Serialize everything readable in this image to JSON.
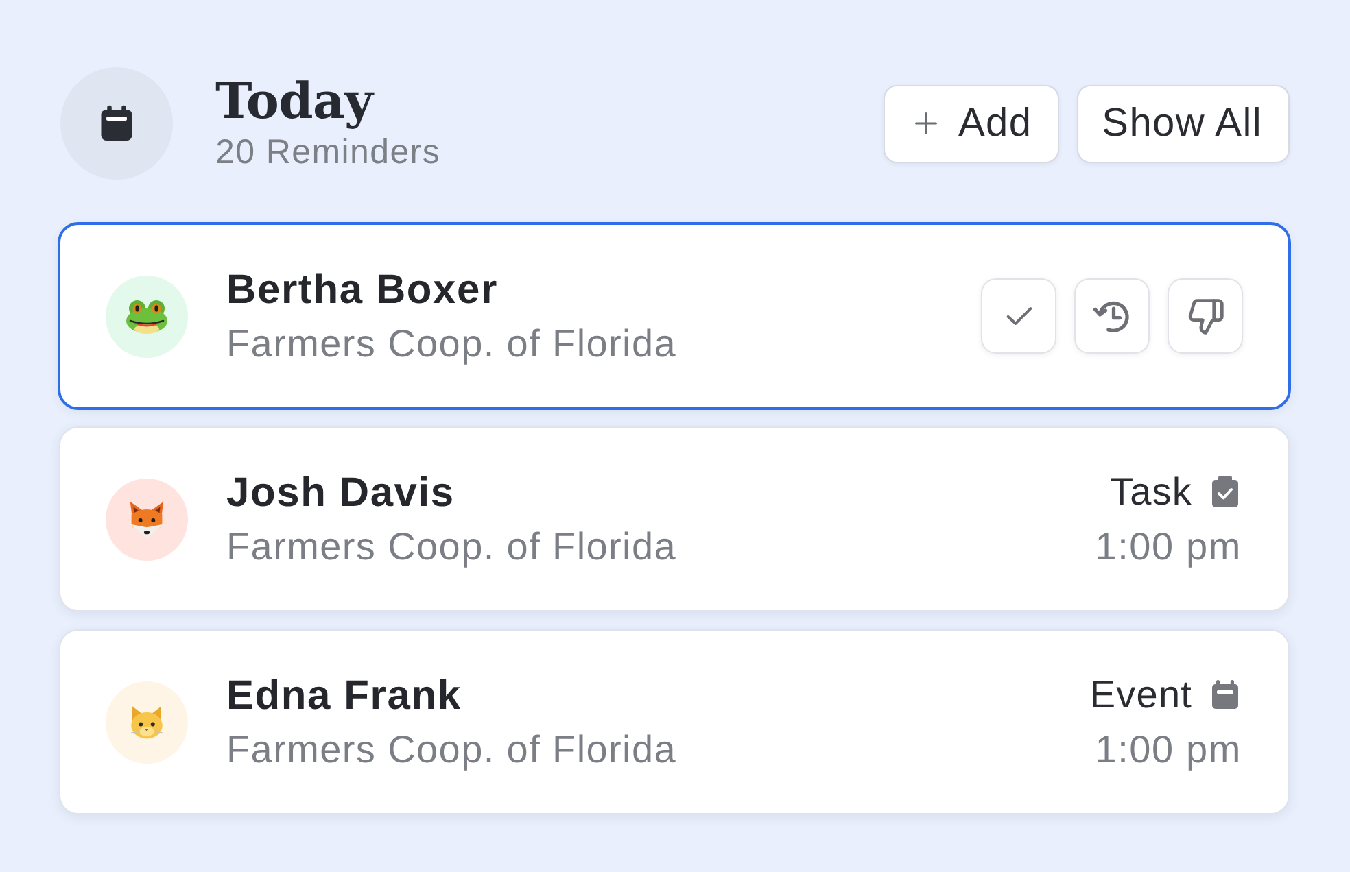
{
  "header": {
    "title": "Today",
    "subtitle": "20 Reminders"
  },
  "buttons": [
    {
      "label": "Add",
      "kind": "add"
    },
    {
      "label": "Show All",
      "kind": "show-all"
    }
  ],
  "reminders": [
    {
      "name": "Bertha Boxer",
      "company": "Farmers Coop. of Florida",
      "selected": true,
      "avatar": {
        "kind": "frog",
        "color": "#e2f9ec"
      },
      "actions": [
        {
          "kind": "check"
        },
        {
          "kind": "history"
        },
        {
          "kind": "thumbs-down"
        }
      ]
    },
    {
      "name": "Josh Davis",
      "company": "Farmers Coop. of Florida",
      "selected": false,
      "avatar": {
        "kind": "fox",
        "color": "#ffe3df"
      },
      "type": {
        "label": "Task",
        "kind": "task"
      },
      "time": "1:00 pm"
    },
    {
      "name": "Edna Frank",
      "company": "Farmers Coop. of Florida",
      "selected": false,
      "avatar": {
        "kind": "cat",
        "color": "#fff5e6"
      },
      "type": {
        "label": "Event",
        "kind": "event"
      },
      "time": "1:00 pm"
    }
  ]
}
